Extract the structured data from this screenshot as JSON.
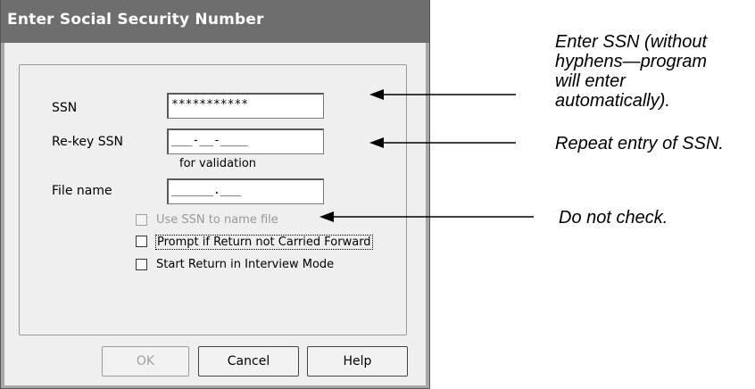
{
  "dialog": {
    "title": "Enter Social Security Number",
    "ssn_label": "SSN",
    "ssn_value": "***********",
    "rekey_label": "Re-key SSN",
    "rekey_value": "___-__-____",
    "rekey_note": "for validation",
    "filename_label": "File name",
    "filename_value": "______.___",
    "checkboxes": [
      {
        "label": "Use SSN to name file",
        "checked": false,
        "enabled": false
      },
      {
        "label": "Prompt if Return not Carried Forward",
        "checked": false,
        "enabled": true
      },
      {
        "label": "Start Return in Interview Mode",
        "checked": false,
        "enabled": true
      }
    ],
    "buttons": {
      "ok": "OK",
      "cancel": "Cancel",
      "help": "Help"
    }
  },
  "annotations": {
    "ssn_note_lines": [
      "Enter SSN (without",
      "hyphens—program",
      "will enter",
      "automatically)."
    ],
    "rekey_note": "Repeat entry of SSN.",
    "checkbox_note": "Do not check."
  }
}
